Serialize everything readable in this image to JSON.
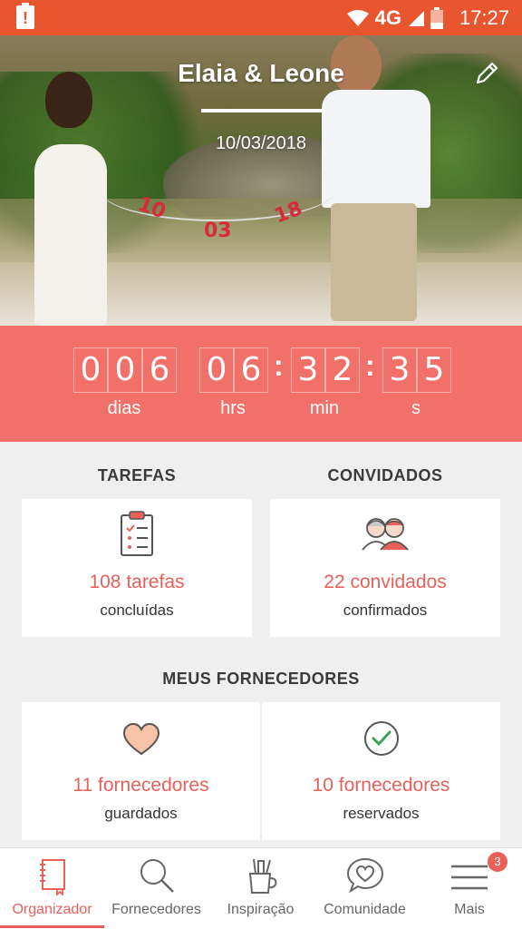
{
  "status_bar": {
    "network": "4G",
    "time": "17:27"
  },
  "hero": {
    "title": "Elaia & Leone",
    "date": "10/03/2018",
    "banner_tags": [
      "10",
      "03",
      "18"
    ]
  },
  "countdown": {
    "days": [
      "0",
      "0",
      "6"
    ],
    "hours": [
      "0",
      "6"
    ],
    "minutes": [
      "3",
      "2"
    ],
    "seconds": [
      "3",
      "5"
    ],
    "labels": {
      "days": "dias",
      "hours": "hrs",
      "minutes": "min",
      "seconds": "s"
    }
  },
  "sections": {
    "tasks": {
      "title": "TAREFAS",
      "count": "108 tarefas",
      "caption": "concluídas"
    },
    "guests": {
      "title": "CONVIDADOS",
      "count": "22 convidados",
      "caption": "confirmados"
    },
    "vendors": {
      "title": "MEUS FORNECEDORES",
      "saved": {
        "count": "11 fornecedores",
        "caption": "guardados"
      },
      "booked": {
        "count": "10 fornecedores",
        "caption": "reservados"
      }
    }
  },
  "bottom_nav": {
    "items": [
      {
        "label": "Organizador",
        "icon": "notebook-icon",
        "active": true
      },
      {
        "label": "Fornecedores",
        "icon": "search-icon"
      },
      {
        "label": "Inspiração",
        "icon": "brushes-icon"
      },
      {
        "label": "Comunidade",
        "icon": "chat-heart-icon"
      },
      {
        "label": "Mais",
        "icon": "menu-icon"
      }
    ],
    "more_badge": "3"
  },
  "colors": {
    "accent": "#e8605a",
    "status_bar": "#e8552f",
    "countdown_bg": "#f2706a"
  }
}
